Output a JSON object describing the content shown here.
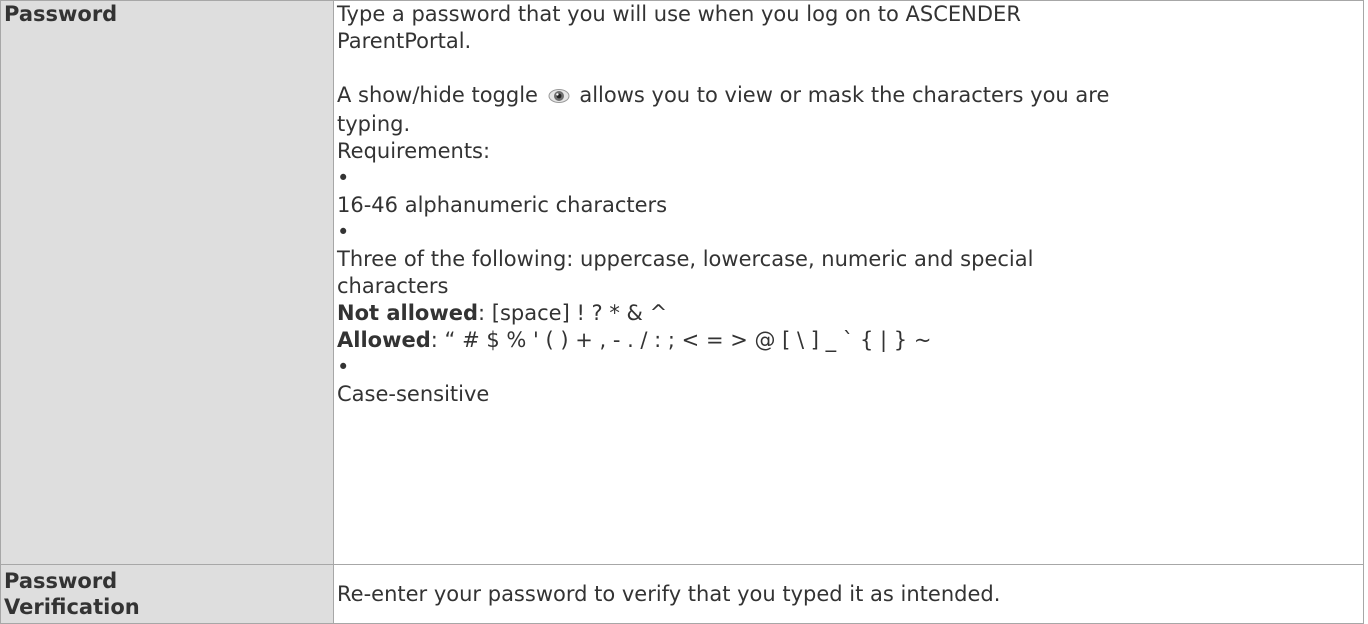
{
  "password_row": {
    "label": "Password",
    "intro_1": "Type a password that you will use when you log on to ASCENDER",
    "intro_2": "ParentPortal.",
    "toggle_before": "A show/hide toggle",
    "toggle_icon": "eye-icon",
    "toggle_after": "allows you to view or mask the characters you are",
    "toggle_after_2": "typing.",
    "requirements_label": "Requirements:",
    "bullet": "•",
    "req_1": "16-46 alphanumeric characters",
    "req_2_line1": "Three of the following: uppercase, lowercase, numeric and special",
    "req_2_line2": "characters",
    "not_allowed_label": "Not allowed",
    "not_allowed_chars": ": [space] ! ? * & ^",
    "allowed_label": "Allowed",
    "allowed_chars": ": “ # $ % ' ( ) + , - . / : ; < = > @ [ \\ ] _ ` { | } ~",
    "req_3": "Case-sensitive"
  },
  "verify_row": {
    "label_line1": "Password",
    "label_line2": "Verification",
    "description": "Re-enter your password to verify that you typed it as intended."
  }
}
